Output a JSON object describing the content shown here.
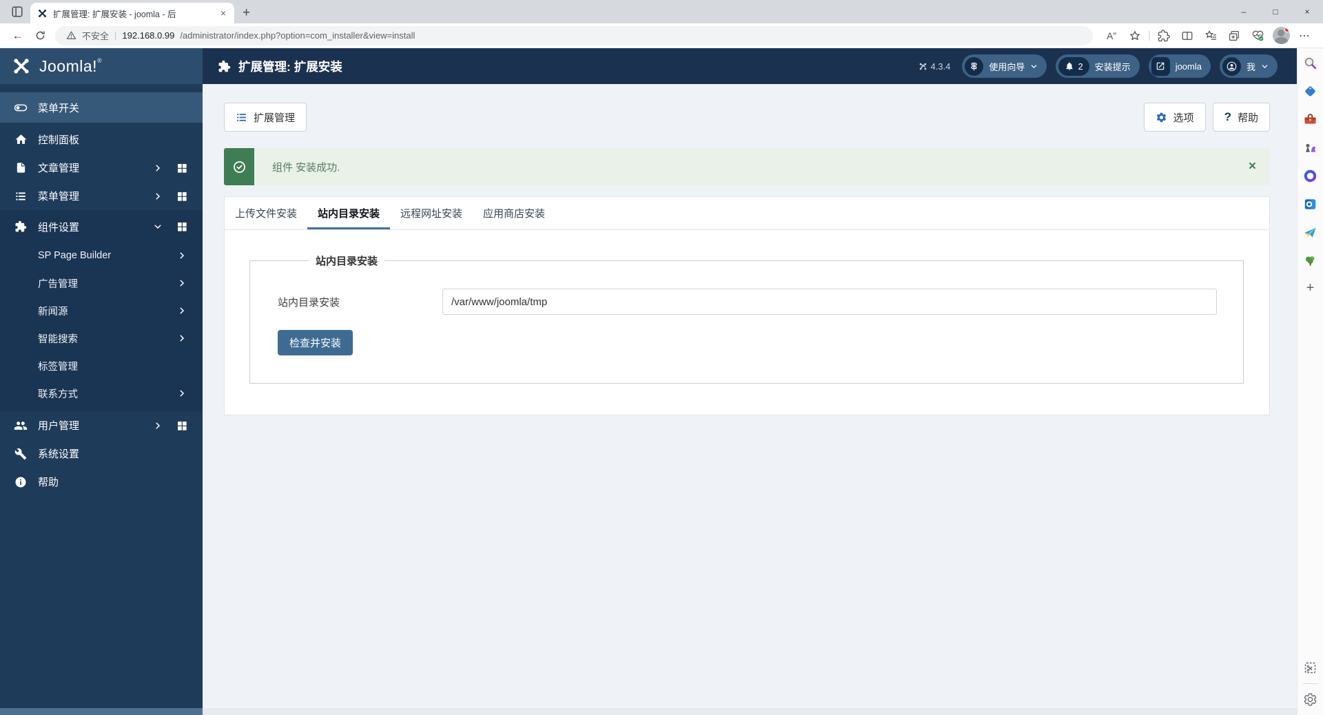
{
  "icons": {
    "back": "←",
    "plus": "+",
    "more": "⋯",
    "minimize": "–",
    "maximize": "□",
    "close": "×",
    "divider": "|",
    "read_aloud": "A”",
    "question": "?",
    "alert_close": "×"
  },
  "browser": {
    "tab_title": "扩展管理: 扩展安装 - joomla - 后",
    "security": "不安全",
    "host": "192.168.0.99",
    "path": "/administrator/index.php?option=com_installer&view=install"
  },
  "app_header": {
    "brand": "Joomla!",
    "brand_reg": "®",
    "title": "扩展管理: 扩展安装",
    "version": "4.3.4",
    "guide": "使用向导",
    "notify_count": "2",
    "notify_label": "安装提示",
    "site_label": "joomla",
    "user_label": "我"
  },
  "sidebar": {
    "toggle_label": "菜单开关",
    "items": [
      {
        "label": "控制面板"
      },
      {
        "label": "文章管理"
      },
      {
        "label": "菜单管理"
      },
      {
        "label": "组件设置"
      },
      {
        "label": "用户管理"
      },
      {
        "label": "系统设置"
      },
      {
        "label": "帮助"
      }
    ],
    "submenu": [
      {
        "label": "SP Page Builder"
      },
      {
        "label": "广告管理"
      },
      {
        "label": "新闻源"
      },
      {
        "label": "智能搜索"
      },
      {
        "label": "标签管理"
      },
      {
        "label": "联系方式"
      }
    ]
  },
  "toolbar": {
    "manage": "扩展管理",
    "options": "选项",
    "help": "帮助"
  },
  "alert": {
    "message": "组件 安装成功."
  },
  "tabs": {
    "items": [
      "上传文件安装",
      "站内目录安装",
      "远程网址安装",
      "应用商店安装"
    ]
  },
  "form": {
    "legend": "站内目录安装",
    "field_label": "站内目录安装",
    "value": "/var/www/joomla/tmp",
    "submit": "检查并安装"
  }
}
